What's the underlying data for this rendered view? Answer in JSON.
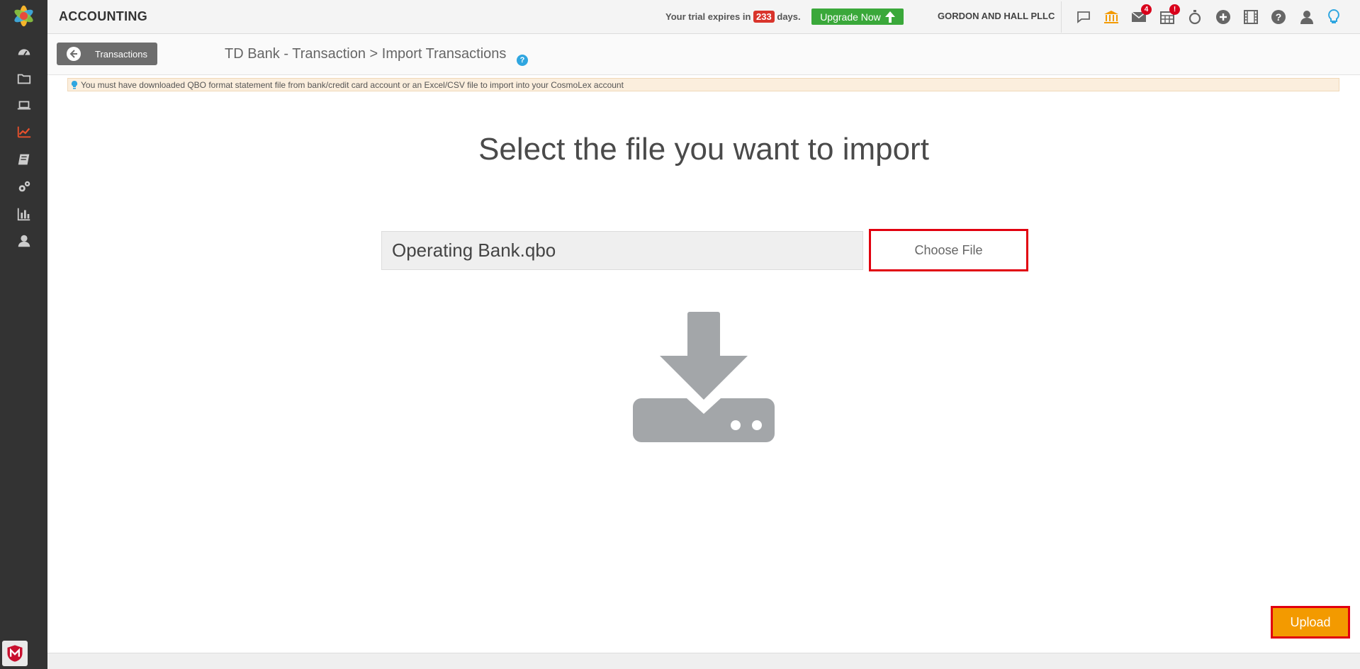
{
  "header": {
    "app_title": "ACCOUNTING",
    "trial_prefix": "Your trial expires in",
    "trial_days": "233",
    "trial_suffix": "days.",
    "upgrade_label": "Upgrade Now",
    "firm_name": "GORDON AND HALL PLLC",
    "mail_badge": "4",
    "calendar_badge": "!"
  },
  "subbar": {
    "back_label": "Transactions",
    "breadcrumb": "TD Bank - Transaction > Import Transactions",
    "help": "?"
  },
  "notice": "You must have downloaded QBO format statement file from bank/credit card account or an Excel/CSV file to import into your CosmoLex account",
  "main": {
    "title": "Select the file you want to import",
    "file_name": "Operating Bank.qbo",
    "choose_label": "Choose File",
    "upload_label": "Upload"
  },
  "colors": {
    "sidebar": "#333333",
    "accent_orange": "#f39a00",
    "upgrade_green": "#3aa83a",
    "highlight_red": "#e1000f",
    "active_nav": "#e8502c"
  },
  "sidebar_icons": [
    "dashboard-icon",
    "folder-icon",
    "laptop-icon",
    "chart-line-icon",
    "book-icon",
    "gears-icon",
    "bar-chart-icon",
    "user-icon"
  ],
  "header_icons": [
    "chat-icon",
    "bank-icon",
    "mail-icon",
    "calendar-icon",
    "stopwatch-icon",
    "plus-circle-icon",
    "film-icon",
    "question-icon",
    "user-icon",
    "lightbulb-icon"
  ]
}
